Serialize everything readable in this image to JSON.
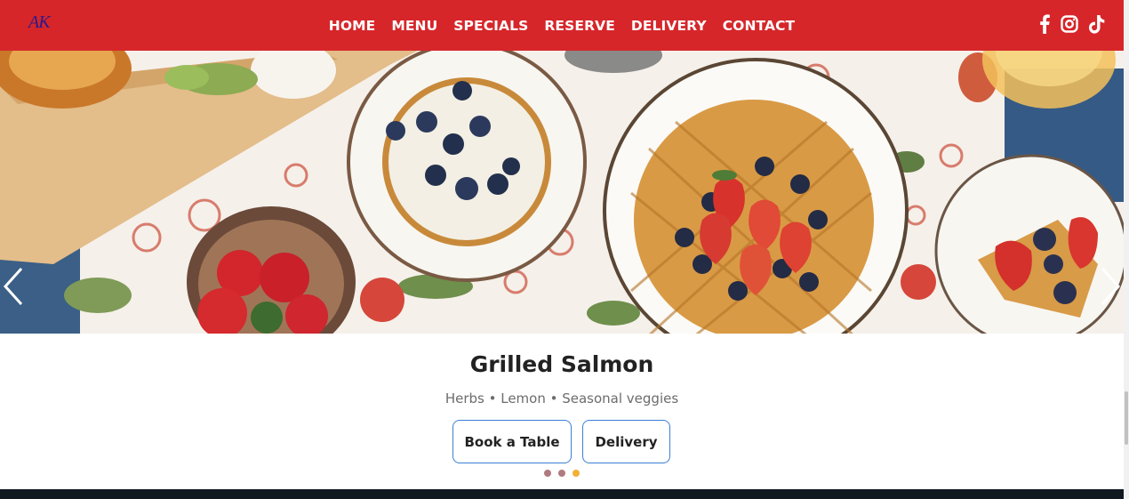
{
  "header": {
    "logo_text": "AK",
    "nav": [
      "HOME",
      "MENU",
      "SPECIALS",
      "RESERVE",
      "DELIVERY",
      "CONTACT"
    ],
    "social_icons": [
      "facebook-icon",
      "instagram-icon",
      "tiktok-icon"
    ]
  },
  "hero": {
    "slide_title": "Grilled Salmon",
    "slide_subtitle": "Herbs • Lemon • Seasonal veggies",
    "buttons": {
      "book": "Book a Table",
      "delivery": "Delivery"
    },
    "slides_total": 3,
    "active_slide": 3
  },
  "colors": {
    "navbar": "#d6262a",
    "button_border": "#3a7fd6",
    "dot_inactive": "#b07a80",
    "dot_active": "#f2b134",
    "footer": "#101820"
  }
}
